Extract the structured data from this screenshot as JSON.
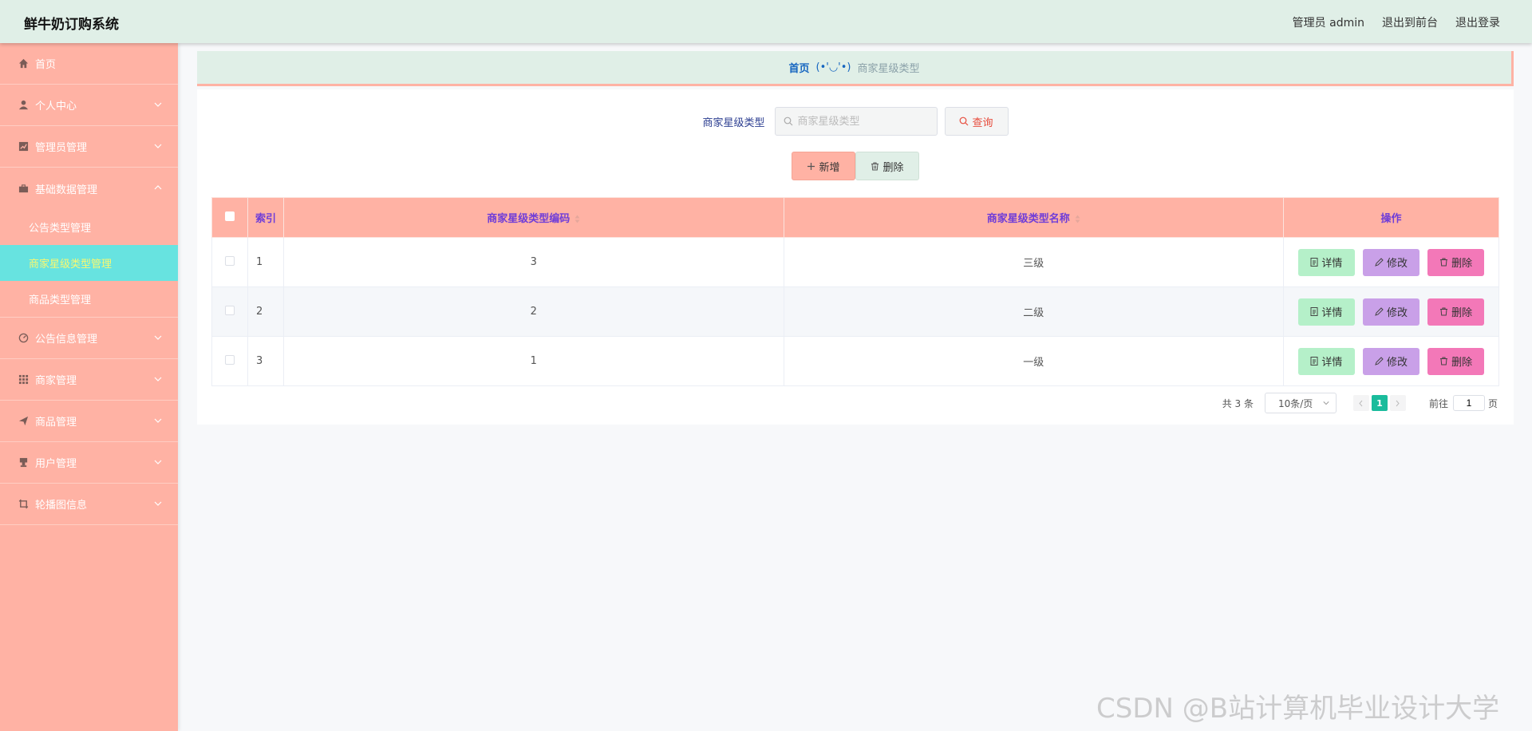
{
  "header": {
    "title": "鲜牛奶订购系统",
    "user": "管理员 admin",
    "to_front": "退出到前台",
    "logout": "退出登录"
  },
  "sidebar": {
    "items": [
      {
        "label": "首页",
        "icon": "home-icon"
      },
      {
        "label": "个人中心",
        "icon": "user-icon"
      },
      {
        "label": "管理员管理",
        "icon": "chart-icon"
      },
      {
        "label": "基础数据管理",
        "icon": "suitcase-icon"
      },
      {
        "label": "公告类型管理"
      },
      {
        "label": "商家星级类型管理"
      },
      {
        "label": "商品类型管理"
      },
      {
        "label": "公告信息管理",
        "icon": "gauge-icon"
      },
      {
        "label": "商家管理",
        "icon": "grid-icon"
      },
      {
        "label": "商品管理",
        "icon": "paper-plane-icon"
      },
      {
        "label": "用户管理",
        "icon": "stamp-icon"
      },
      {
        "label": "轮播图信息",
        "icon": "crop-icon"
      }
    ]
  },
  "breadcrumb": {
    "home": "首页",
    "separator": "(•'◡'•)",
    "current": "商家星级类型"
  },
  "search": {
    "label": "商家星级类型",
    "placeholder": "商家星级类型",
    "query_label": "查询"
  },
  "actions": {
    "add_label": "新增",
    "delete_label": "删除"
  },
  "table": {
    "headers": [
      "索引",
      "商家星级类型编码",
      "商家星级类型名称",
      "操作"
    ],
    "rows": [
      {
        "index": "1",
        "code": "3",
        "name": "三级"
      },
      {
        "index": "2",
        "code": "2",
        "name": "二级"
      },
      {
        "index": "3",
        "code": "1",
        "name": "一级"
      }
    ],
    "op_detail": "详情",
    "op_edit": "修改",
    "op_delete": "删除"
  },
  "pager": {
    "total": "共 3 条",
    "page_size": "10条/页",
    "current_page": "1",
    "goto_label": "前往",
    "goto_value": "1",
    "page_unit": "页"
  },
  "watermark": "CSDN @B站计算机毕业设计大学",
  "colors": {
    "header_bg": "#e0efe7",
    "sidebar_bg": "#ffb2a4",
    "active_item_bg": "#67e3e0",
    "active_item_text": "#f9f871",
    "table_head_text": "#6f3dd8",
    "detail_btn": "#b5f0c9",
    "edit_btn": "#c9a0e8",
    "delete_btn": "#f378b8",
    "pager_active": "#1abc9c"
  }
}
